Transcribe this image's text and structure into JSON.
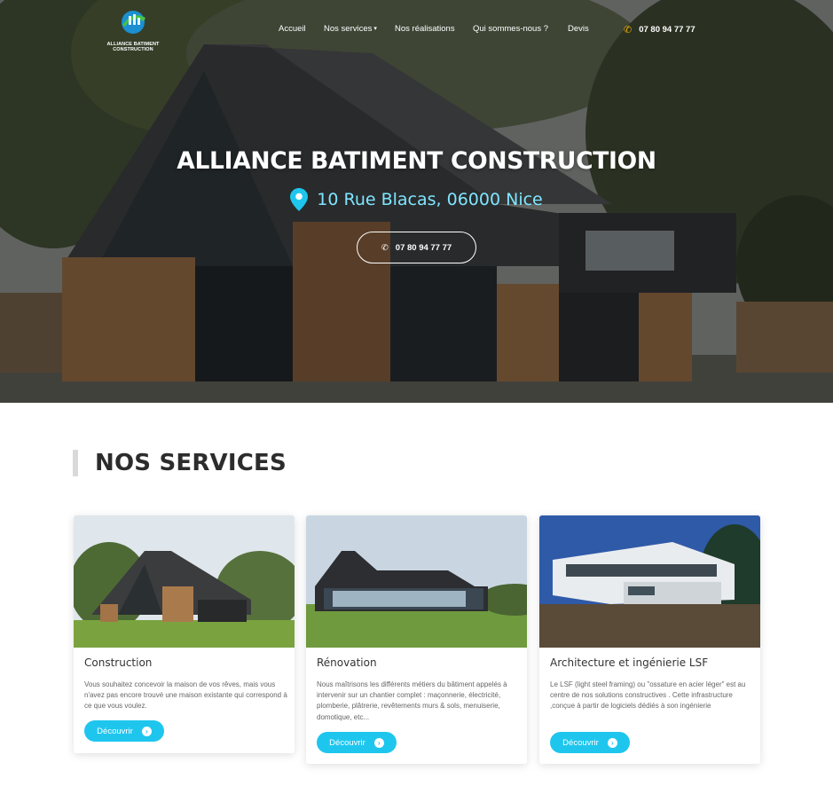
{
  "brand": {
    "logo_text": "ALLIANCE BATIMENT CONSTRUCTION"
  },
  "nav": {
    "items": [
      {
        "label": "Accueil"
      },
      {
        "label": "Nos services",
        "icon": "chevron-down-icon"
      },
      {
        "label": "Nos réalisations"
      },
      {
        "label": "Qui sommes-nous ?"
      },
      {
        "label": "Devis"
      }
    ],
    "phone": "07 80 94 77 77"
  },
  "hero": {
    "title": "ALLIANCE BATIMENT CONSTRUCTION",
    "address": "10 Rue Blacas, 06000 Nice",
    "button_label": "07 80 94 77 77"
  },
  "services": {
    "heading": "NOS SERVICES",
    "cards": [
      {
        "title": "Construction",
        "description": "Vous souhaitez concevoir la maison de vos rêves, mais vous n'avez pas encore trouvé une maison existante qui correspond à ce que vous voulez.",
        "button_label": "Découvrir"
      },
      {
        "title": "Rénovation",
        "description": "Nous maîtrisons les différents métiers du bâtiment appelés à intervenir sur un chantier complet : maçonnerie, électricité, plomberie, plâtrerie, revêtements murs & sols, menuiserie, domotique, etc...",
        "button_label": "Découvrir"
      },
      {
        "title": "Architecture et ingénierie LSF",
        "description": "Le LSF (light steel framing) ou \"ossature en acier léger\" est au centre de nos solutions constructives . Cette infrastructure ,conçue à partir de logiciels dédiés à son ingénierie",
        "button_label": "Découvrir"
      }
    ]
  },
  "colors": {
    "accent": "#1ec6ee",
    "address": "#7fe6ff",
    "phone_icon": "#f6b400"
  }
}
